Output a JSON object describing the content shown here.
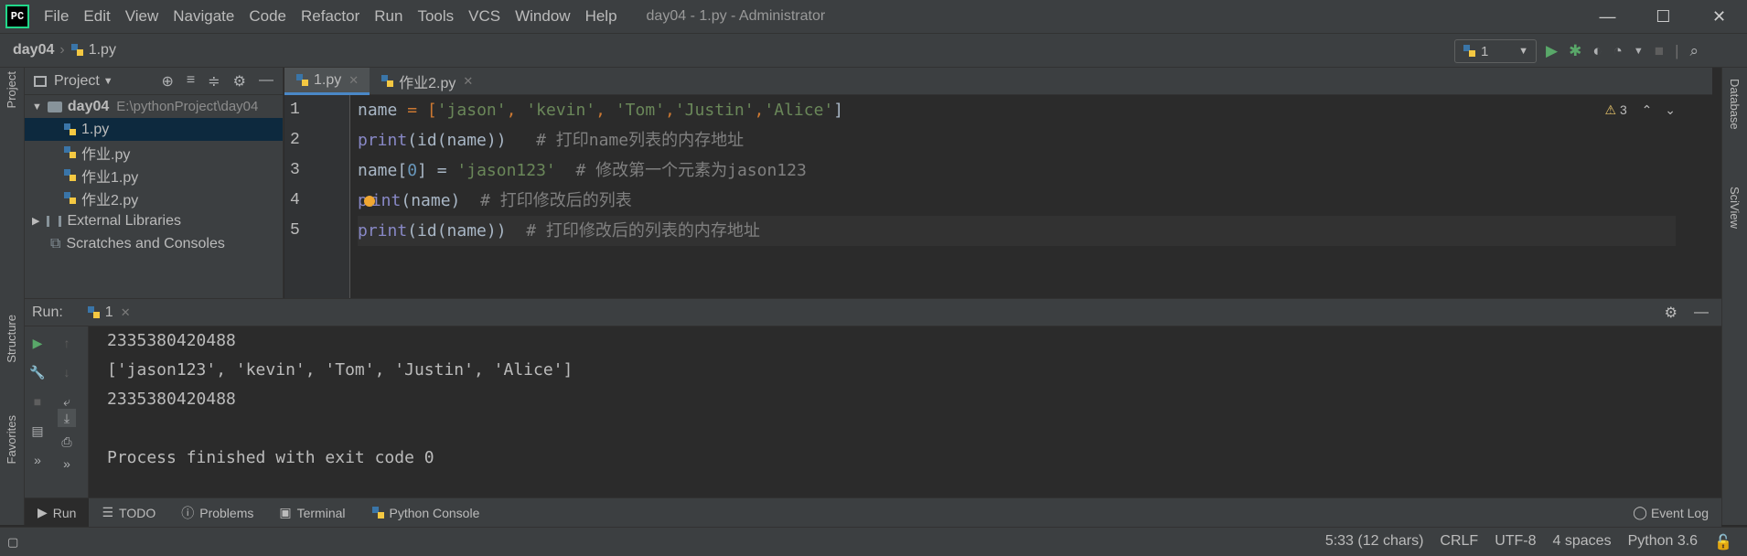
{
  "app": {
    "window_title": "day04 - 1.py - Administrator",
    "logo_text": "PC"
  },
  "menu": [
    "File",
    "Edit",
    "View",
    "Navigate",
    "Code",
    "Refactor",
    "Run",
    "Tools",
    "VCS",
    "Window",
    "Help"
  ],
  "window_controls": {
    "minimize": "—",
    "maximize": "☐",
    "close": "✕"
  },
  "breadcrumb": {
    "project": "day04",
    "file": "1.py"
  },
  "run_config": {
    "label": "1"
  },
  "left_tabs": {
    "project": "Project",
    "structure": "Structure",
    "favorites": "Favorites"
  },
  "right_tabs": {
    "database": "Database",
    "sciview": "SciView"
  },
  "project_panel": {
    "title": "Project",
    "root": {
      "name": "day04",
      "path": "E:\\pythonProject\\day04"
    },
    "files": [
      "1.py",
      "作业.py",
      "作业1.py",
      "作业2.py"
    ],
    "external": "External Libraries",
    "scratches": "Scratches and Consoles"
  },
  "editor_tabs": [
    {
      "label": "1.py",
      "active": true
    },
    {
      "label": "作业2.py",
      "active": false
    }
  ],
  "editor": {
    "line_numbers": [
      "1",
      "2",
      "3",
      "4",
      "5"
    ],
    "warnings": "3",
    "line1": {
      "a": "name",
      "b": " = [",
      "c": "'jason'",
      "d": ", ",
      "e": "'kevin'",
      "f": ", ",
      "g": "'Tom'",
      "h": ",",
      "i": "'Justin'",
      "j": ",",
      "k": "'Alice'",
      "l": "]"
    },
    "line2": {
      "fn": "print",
      "mid": "(id(name))",
      "cmt": "   # 打印name列表的内存地址"
    },
    "line3": {
      "a": "name[",
      "n": "0",
      "b": "] = ",
      "s": "'jason123'",
      "cmt": "  # 修改第一个元素为jason123"
    },
    "line4": {
      "p": "p",
      "rest": "int",
      "mid": "(name)",
      "cmt": "  # 打印修改后的列表"
    },
    "line5": {
      "fn": "print",
      "mid": "(id(name))",
      "cmt": "  # 打印修改后的列表的内存地址"
    }
  },
  "run_panel": {
    "label": "Run:",
    "tab": "1",
    "output": [
      "2335380420488",
      "['jason123', 'kevin', 'Tom', 'Justin', 'Alice']",
      "2335380420488",
      "",
      "Process finished with exit code 0"
    ]
  },
  "bottom_tabs": [
    "Run",
    "TODO",
    "Problems",
    "Terminal",
    "Python Console"
  ],
  "event_log": "Event Log",
  "status": {
    "position": "5:33 (12 chars)",
    "line_sep": "CRLF",
    "encoding": "UTF-8",
    "indent": "4 spaces",
    "interpreter": "Python 3.6"
  }
}
